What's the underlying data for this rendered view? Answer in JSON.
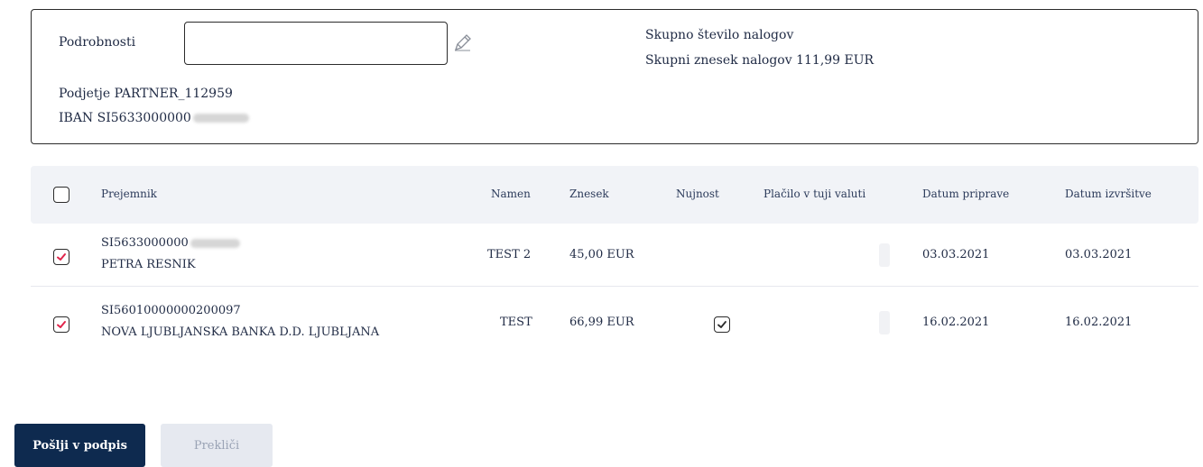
{
  "details": {
    "label": "Podrobnosti",
    "input_value": "",
    "input_placeholder": "",
    "company": "Podjetje PARTNER_112959",
    "iban_prefix": "IBAN SI5633000000",
    "total_count_label": "Skupno število nalogov",
    "total_amount_label": "Skupni znesek nalogov 111,99 EUR"
  },
  "table": {
    "headers": {
      "recipient": "Prejemnik",
      "purpose": "Namen",
      "amount": "Znesek",
      "urgency": "Nujnost",
      "foreign_currency": "Plačilo v tuji valuti",
      "prep_date": "Datum priprave",
      "exec_date": "Datum izvršitve"
    },
    "rows": [
      {
        "checked": true,
        "account": "SI5633000000",
        "name": "PETRA RESNIK",
        "purpose": "TEST 2",
        "amount": "45,00 EUR",
        "urgent": false,
        "prep_date": "03.03.2021",
        "exec_date": "03.03.2021"
      },
      {
        "checked": true,
        "account": "SI56010000000200097",
        "name": "NOVA LJUBLJANSKA BANKA D.D. LJUBLJANA",
        "purpose": "TEST",
        "amount": "66,99 EUR",
        "urgent": true,
        "prep_date": "16.02.2021",
        "exec_date": "16.02.2021"
      }
    ]
  },
  "buttons": {
    "send": "Pošlji v podpis",
    "cancel": "Prekliči"
  },
  "colors": {
    "primary": "#0e2a4f",
    "check": "#e0244a",
    "header_bg": "#f1f3f7"
  }
}
